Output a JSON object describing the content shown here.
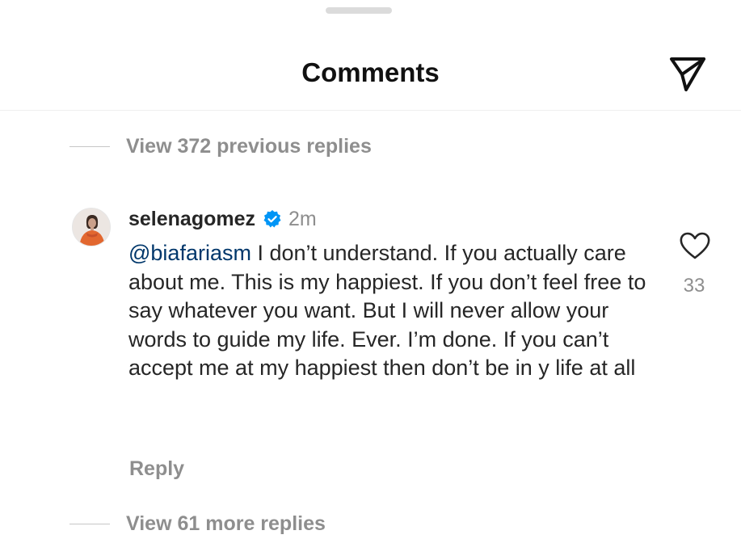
{
  "header": {
    "title": "Comments",
    "share_icon": "paper-plane-icon"
  },
  "replies": {
    "previous_label": "View 372 previous replies",
    "more_label": "View 61 more replies"
  },
  "comment": {
    "username": "selenagomez",
    "verified_icon": "verified-badge-icon",
    "timestamp": "2m",
    "mention": "@biafariasm",
    "text": " I don’t understand. If you actually care about me. This is my happiest. If you don’t feel free to say whatever you want. But I will never allow your words to guide my life. Ever. I’m done. If you can’t accept me at my happiest then don’t be in y life at all",
    "reply_label": "Reply",
    "like_icon": "heart-icon",
    "like_count": "33"
  },
  "colors": {
    "text_primary": "#262626",
    "text_secondary": "#8e8e8e",
    "mention": "#00376b",
    "verified": "#0095f6"
  }
}
